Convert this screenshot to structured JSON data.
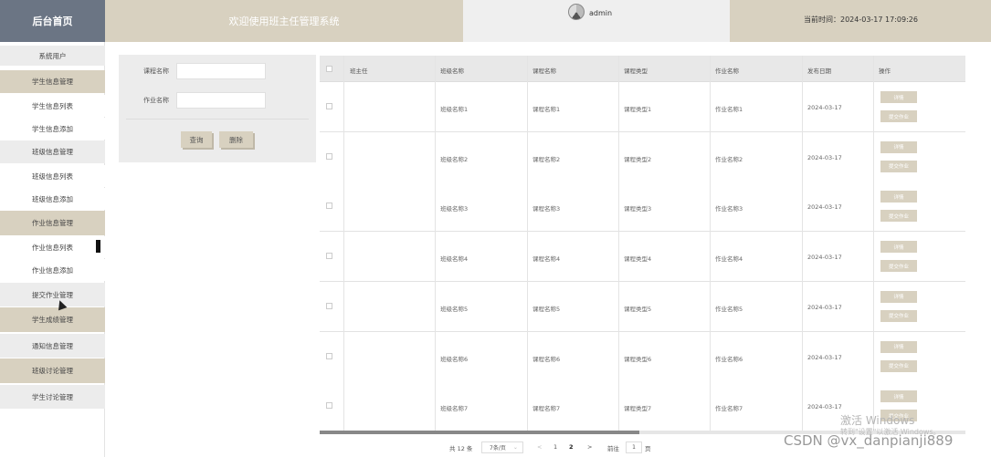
{
  "header": {
    "logo": "后台首页",
    "welcome": "欢迎使用班主任管理系统",
    "username": "admin",
    "time": "当前时间：2024-03-17 17:09:26"
  },
  "sidebar": {
    "items": [
      {
        "label": "系统用户",
        "style": "gray"
      },
      {
        "label": "学生信息管理",
        "style": "head"
      },
      {
        "label": "学生信息列表",
        "style": "white"
      },
      {
        "label": "学生信息添加",
        "style": "white"
      },
      {
        "label": "班级信息管理",
        "style": "gray"
      },
      {
        "label": "班级信息列表",
        "style": "white"
      },
      {
        "label": "班级信息添加",
        "style": "white"
      },
      {
        "label": "作业信息管理",
        "style": "head"
      },
      {
        "label": "作业信息列表",
        "style": "white"
      },
      {
        "label": "作业信息添加",
        "style": "white"
      },
      {
        "label": "提交作业管理",
        "style": "gray"
      },
      {
        "label": "学生成绩管理",
        "style": "head"
      },
      {
        "label": "通知信息管理",
        "style": "gray"
      },
      {
        "label": "班级讨论管理",
        "style": "head"
      },
      {
        "label": "学生讨论管理",
        "style": "gray"
      }
    ]
  },
  "search": {
    "course_label": "课程名称",
    "homework_label": "作业名称",
    "course_value": "",
    "homework_value": "",
    "query_button": "查询",
    "delete_button": "删除"
  },
  "table": {
    "headers": [
      "班主任",
      "班级名称",
      "课程名称",
      "课程类型",
      "作业名称",
      "发布日期",
      "操作"
    ],
    "detail_label": "详情",
    "submit_label": "提交作业",
    "rows": [
      {
        "class": "班级名称1",
        "course": "课程名称1",
        "type": "课程类型1",
        "homework": "作业名称1",
        "date": "2024-03-17"
      },
      {
        "class": "班级名称2",
        "course": "课程名称2",
        "type": "课程类型2",
        "homework": "作业名称2",
        "date": "2024-03-17"
      },
      {
        "class": "班级名称3",
        "course": "课程名称3",
        "type": "课程类型3",
        "homework": "作业名称3",
        "date": "2024-03-17"
      },
      {
        "class": "班级名称4",
        "course": "课程名称4",
        "type": "课程类型4",
        "homework": "作业名称4",
        "date": "2024-03-17"
      },
      {
        "class": "班级名称5",
        "course": "课程名称5",
        "type": "课程类型5",
        "homework": "作业名称5",
        "date": "2024-03-17"
      },
      {
        "class": "班级名称6",
        "course": "课程名称6",
        "type": "课程类型6",
        "homework": "作业名称6",
        "date": "2024-03-17"
      },
      {
        "class": "班级名称7",
        "course": "课程名称7",
        "type": "课程类型7",
        "homework": "作业名称7",
        "date": "2024-03-17"
      }
    ]
  },
  "pagination": {
    "total": "共 12 条",
    "page_size": "7条/页",
    "prev": "<",
    "page1": "1",
    "page2": "2",
    "next": ">",
    "goto_label": "前往",
    "goto_value": "1",
    "goto_suffix": "页"
  },
  "watermark": {
    "activate": "激活 Windows",
    "activate_sub": "转到\"设置\"以激活 Windows。",
    "csdn": "CSDN @vx_danpianji889"
  }
}
